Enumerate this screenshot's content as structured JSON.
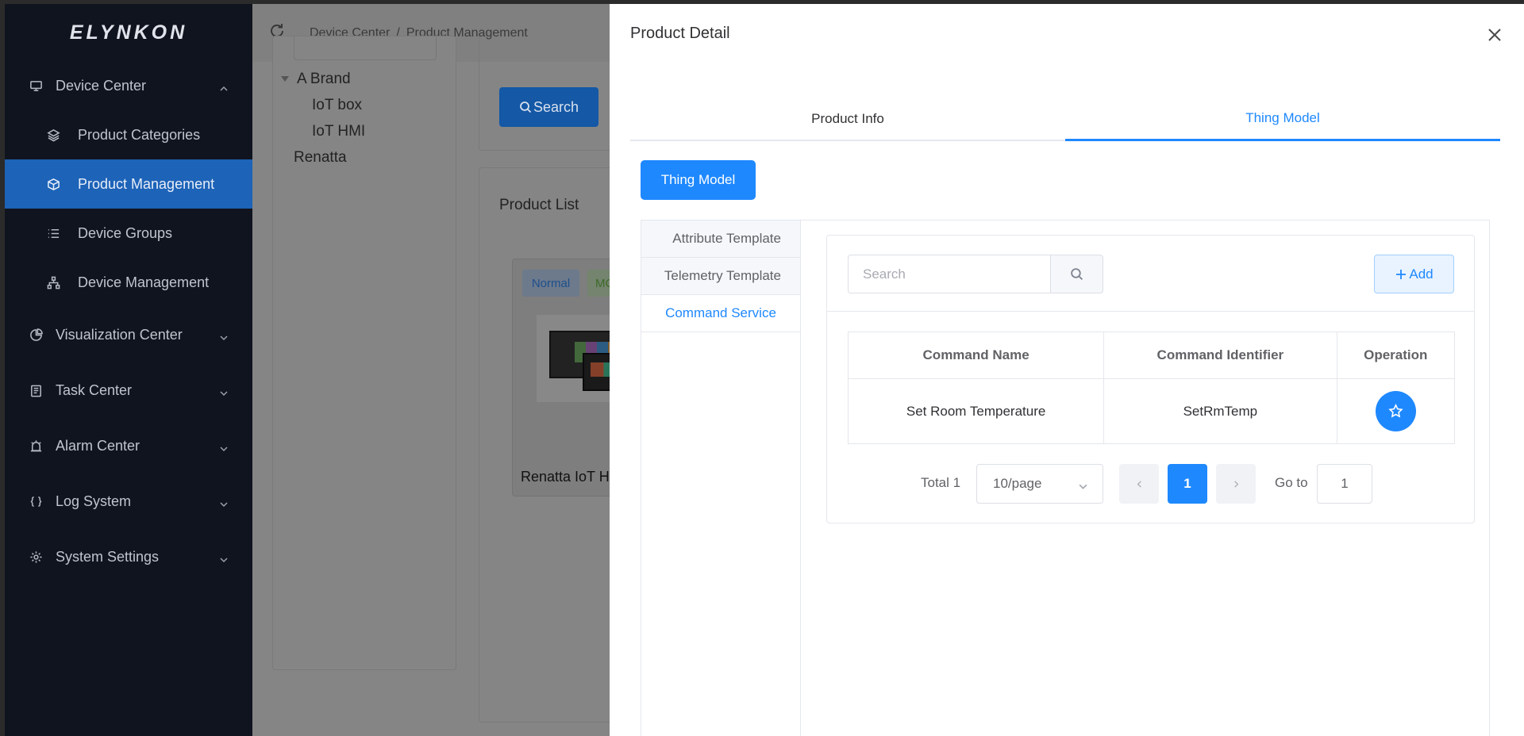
{
  "sidebar": {
    "logo": "ELYNKON",
    "menus": {
      "device_center": "Device Center",
      "product_categories": "Product Categories",
      "product_management": "Product Management",
      "device_groups": "Device Groups",
      "device_management": "Device Management",
      "visualization_center": "Visualization Center",
      "task_center": "Task Center",
      "alarm_center": "Alarm Center",
      "log_system": "Log System",
      "system_settings": "System Settings"
    },
    "active_item": "Product Management"
  },
  "header": {
    "breadcrumb": [
      "Device Center",
      "/",
      "Product Management"
    ]
  },
  "background_page": {
    "tree": {
      "brand": "A Brand",
      "children": [
        "IoT box",
        "IoT HMI"
      ],
      "other": "Renatta"
    },
    "search_button": "Search",
    "product_list_title": "Product List",
    "product_card": {
      "tag_normal": "Normal",
      "tag_second": "MC",
      "name": "Renatta IoT H"
    }
  },
  "drawer": {
    "title": "Product Detail",
    "tabs": [
      "Product Info",
      "Thing Model"
    ],
    "active_tab": "Thing Model",
    "thing_model_button": "Thing Model",
    "side_tabs": [
      "Attribute Template",
      "Telemetry Template",
      "Command Service"
    ],
    "active_side_tab": "Command Service",
    "search_placeholder": "Search",
    "add_button": "Add",
    "table": {
      "headers": [
        "Command Name",
        "Command Identifier",
        "Operation"
      ],
      "rows": [
        {
          "name": "Set Room Temperature",
          "identifier": "SetRmTemp"
        }
      ]
    },
    "pagination": {
      "total": "Total 1",
      "page_size": "10/page",
      "current_page": "1",
      "goto_label": "Go to",
      "goto_value": "1"
    }
  },
  "colors": {
    "primary": "#1e88ff",
    "sidebar_bg": "#10141f",
    "sidebar_active": "#1d63b8"
  }
}
